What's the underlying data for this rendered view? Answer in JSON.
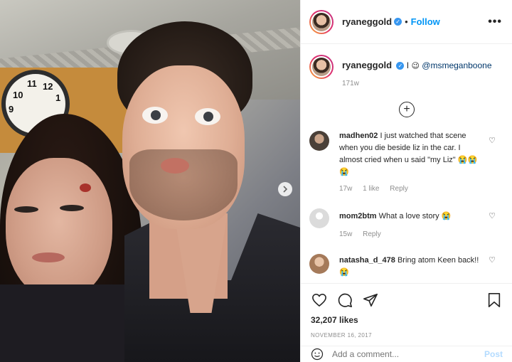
{
  "post": {
    "username": "ryaneggold",
    "follow_label": "Follow",
    "more_label": "•••",
    "caption_text": "I 😉 @msmeganboone",
    "caption_prefix": "I",
    "caption_emoji": "😉",
    "caption_mention": "@msmeganboone",
    "caption_age": "171w",
    "load_more_label": "+"
  },
  "comments": [
    {
      "user": "madhen02",
      "text": "I just watched that scene when you die beside liz in the car. I almost cried when u said \"my Liz\" 😭😭😭",
      "age": "17w",
      "likes": "1 like",
      "reply": "Reply",
      "avatar_color": "#4a4038"
    },
    {
      "user": "mom2btm",
      "text": "What a love story 😭",
      "age": "15w",
      "reply": "Reply",
      "avatar_color": "#dbdbdb"
    },
    {
      "user": "natasha_d_478",
      "text": "Bring atom Keen back!! 😭",
      "avatar_color": "#a57a5a"
    }
  ],
  "actions": {
    "likes": "32,207 likes",
    "date": "NOVEMBER 16, 2017"
  },
  "add_comment": {
    "placeholder": "Add a comment...",
    "post_label": "Post"
  },
  "colors": {
    "accent": "#0095f6",
    "verified": "#3897f0",
    "muted": "#8e8e8e"
  }
}
